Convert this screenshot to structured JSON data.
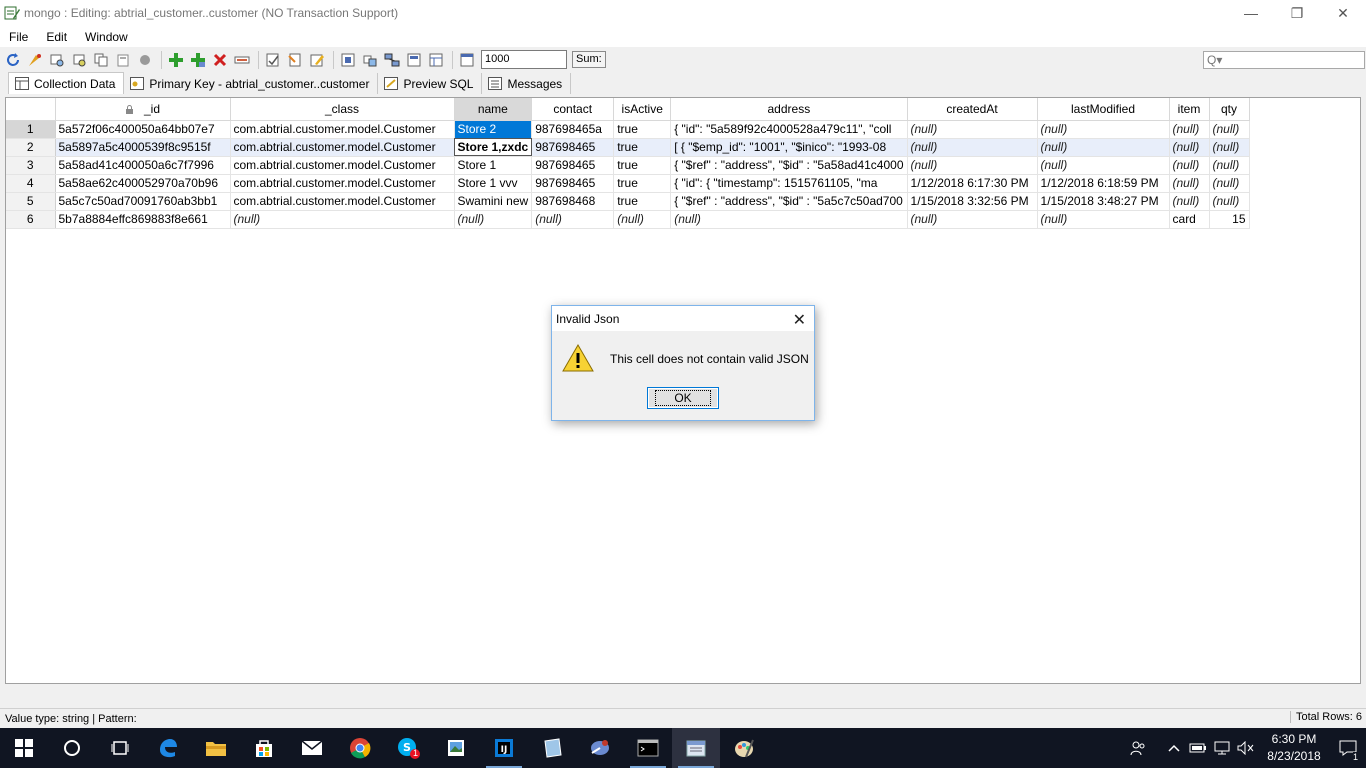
{
  "window": {
    "title": "mongo : Editing: abtrial_customer..customer (NO Transaction Support)",
    "minimize": "—",
    "restore": "❐",
    "close": "✕"
  },
  "menu": [
    "File",
    "Edit",
    "Window"
  ],
  "toolbar": {
    "rows_value": "1000",
    "sum_label": "Sum:",
    "search_placeholder": "Q▾"
  },
  "tabs": [
    {
      "label": "Collection Data",
      "active": true
    },
    {
      "label": "Primary Key - abtrial_customer..customer",
      "active": false
    },
    {
      "label": "Preview SQL",
      "active": false
    },
    {
      "label": "Messages",
      "active": false
    }
  ],
  "grid": {
    "columns": [
      "_id",
      "_class",
      "name",
      "contact",
      "isActive",
      "address",
      "createdAt",
      "lastModified",
      "item",
      "qty"
    ],
    "rows": [
      [
        "1",
        "5a572f06c400050a64bb07e7",
        "com.abtrial.customer.model.Customer",
        "Store 2",
        "987698465a",
        "true",
        "{  \"id\": \"5a589f92c4000528a479c11\",  \"coll",
        "(null)",
        "(null)",
        "(null)",
        "(null)"
      ],
      [
        "2",
        "5a5897a5c4000539f8c9515f",
        "com.abtrial.customer.model.Customer",
        "Store 1,zxdc",
        "987698465",
        "true",
        "[  {    \"$emp_id\": \"1001\",    \"$inico\": \"1993-08",
        "(null)",
        "(null)",
        "(null)",
        "(null)"
      ],
      [
        "3",
        "5a58ad41c400050a6c7f7996",
        "com.abtrial.customer.model.Customer",
        "Store 1",
        "987698465",
        "true",
        "{ \"$ref\" : \"address\", \"$id\" : \"5a58ad41c4000",
        "(null)",
        "(null)",
        "(null)",
        "(null)"
      ],
      [
        "4",
        "5a58ae62c400052970a70b96",
        "com.abtrial.customer.model.Customer",
        "Store 1 vvv",
        "987698465",
        "true",
        "{  \"id\": {    \"timestamp\": 1515761105,    \"ma",
        "1/12/2018 6:17:30 PM",
        "1/12/2018 6:18:59 PM",
        "(null)",
        "(null)"
      ],
      [
        "5",
        "5a5c7c50ad70091760ab3bb1",
        "com.abtrial.customer.model.Customer",
        "Swamini new",
        "987698468",
        "true",
        "{ \"$ref\" : \"address\", \"$id\" : \"5a5c7c50ad700",
        "1/15/2018 3:32:56 PM",
        "1/15/2018 3:48:27 PM",
        "(null)",
        "(null)"
      ],
      [
        "6",
        "5b7a8884effc869883f8e661",
        "(null)",
        "(null)",
        "(null)",
        "(null)",
        "(null)",
        "(null)",
        "(null)",
        "card",
        "15"
      ]
    ]
  },
  "status": {
    "left": "Value type: string | Pattern:",
    "right": "Total Rows: 6"
  },
  "dialog": {
    "title": "Invalid Json",
    "message": "This cell does not contain valid JSON",
    "ok": "OK",
    "close": "✕"
  },
  "taskbar": {
    "time": "6:30 PM",
    "date": "8/23/2018",
    "notification_count": "1",
    "skype_badge": "1"
  }
}
